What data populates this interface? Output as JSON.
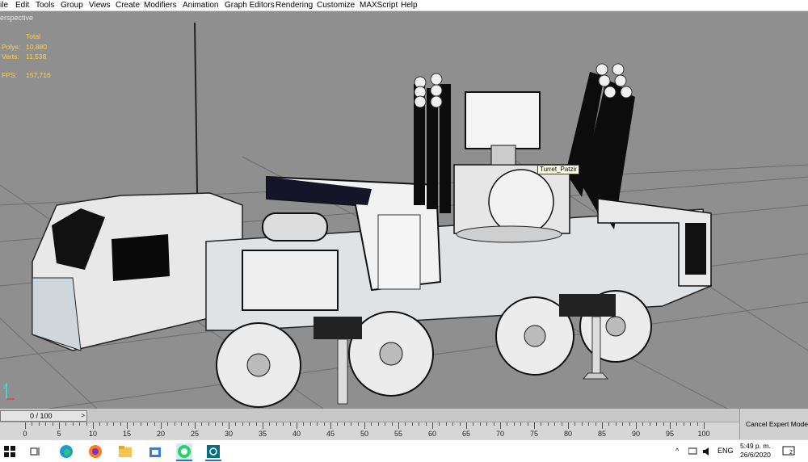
{
  "menu": [
    "ile",
    "Edit",
    "Tools",
    "Group",
    "Views",
    "Create",
    "Modifiers",
    "Animation",
    "Graph Editors",
    "Rendering",
    "Customize",
    "MAXScript",
    "Help"
  ],
  "viewport": {
    "label": "erspective",
    "stats": {
      "header": "Total",
      "polys_label": "Polys:",
      "polys_value": "10,880",
      "verts_label": "Verts:",
      "verts_value": "11,538",
      "fps_label": "FPS:",
      "fps_value": "157,716"
    },
    "tooltip": "Turret_Patzir",
    "axis_label": "z"
  },
  "timeline": {
    "frame_label": "0 / 100",
    "next_arrow": ">",
    "ruler_numbers": [
      "0",
      "5",
      "10",
      "15",
      "20",
      "25",
      "30",
      "35",
      "40",
      "45",
      "50",
      "55",
      "60",
      "65",
      "70",
      "75",
      "80",
      "85",
      "90",
      "95",
      "100"
    ],
    "cancel_mode": "Cancel Expert Mode"
  },
  "taskbar": {
    "icons": [
      "windows-start-icon",
      "task-view-icon",
      "edge-icon",
      "firefox-icon",
      "file-explorer-icon",
      "store-icon",
      "whatsapp-icon",
      "3dsmax-icon"
    ],
    "tray_chevron": "^",
    "language": "ENG",
    "time": "5:49 p. m.",
    "date": "26/6/2020",
    "notification_count": "2"
  },
  "colors": {
    "accent_yellow": "#f0c000",
    "stats_text": "#ffd24a",
    "taskbar_blue": "#2f6fd0"
  }
}
